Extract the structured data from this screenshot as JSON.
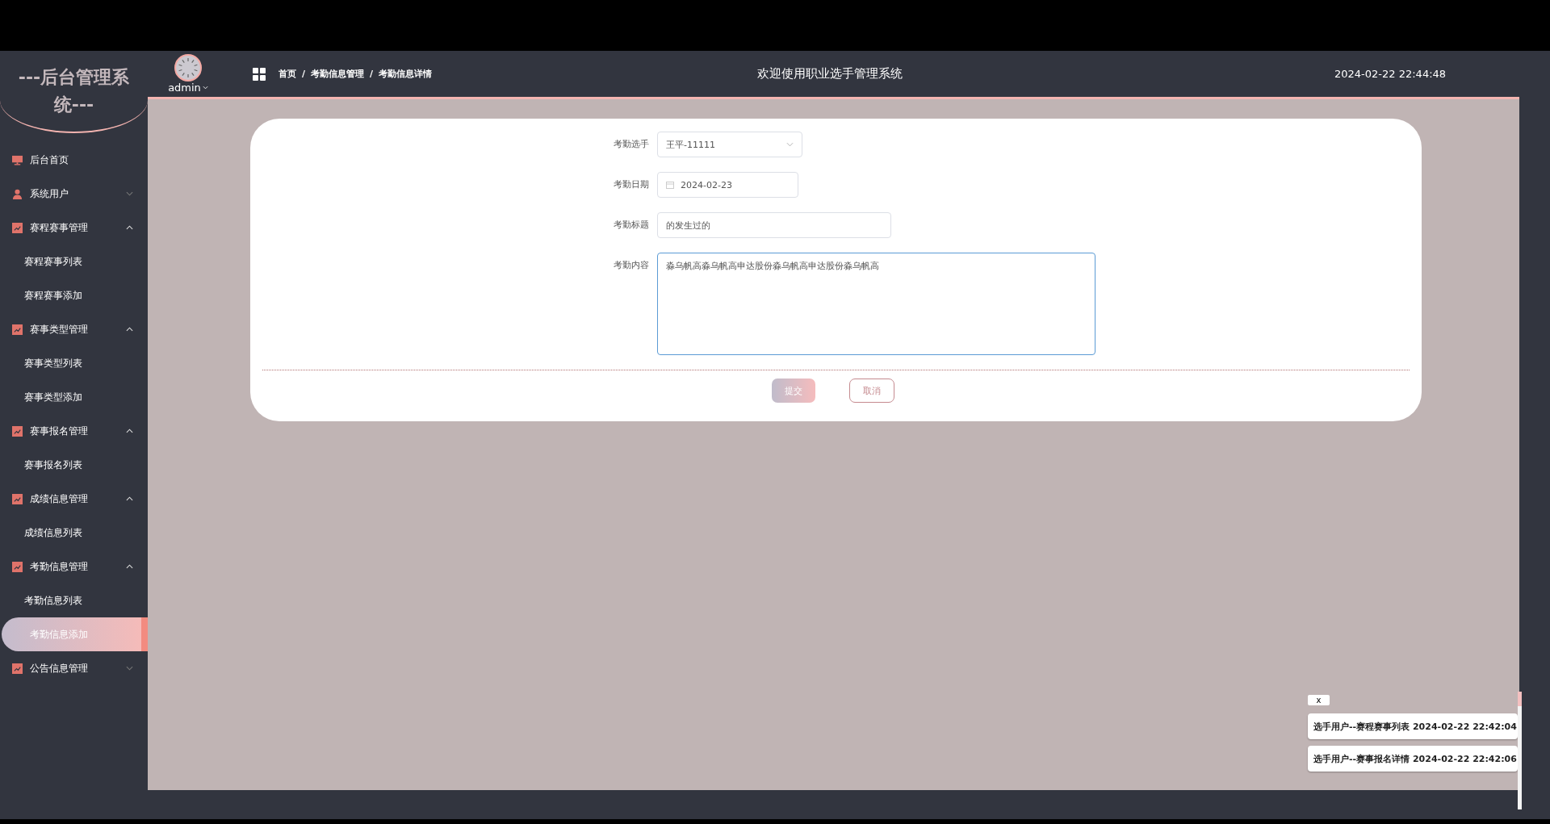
{
  "logo": {
    "title": "---后台管理系统---"
  },
  "user": {
    "name": "admin"
  },
  "breadcrumb": {
    "separator": "/",
    "items": [
      "首页",
      "考勤信息管理",
      "考勤信息详情"
    ]
  },
  "header": {
    "title": "欢迎使用职业选手管理系统",
    "time": "2024-02-22 22:44:48"
  },
  "sidebar": {
    "items": [
      {
        "kind": "home",
        "label": "后台首页",
        "selected": false
      },
      {
        "kind": "user",
        "label": "系统用户",
        "expanded": false,
        "selected": false
      },
      {
        "kind": "group",
        "label": "赛程赛事管理",
        "expanded": true,
        "selected": false
      },
      {
        "kind": "sub",
        "label": "赛程赛事列表",
        "selected": false
      },
      {
        "kind": "sub",
        "label": "赛程赛事添加",
        "selected": false
      },
      {
        "kind": "group",
        "label": "赛事类型管理",
        "expanded": true,
        "selected": false
      },
      {
        "kind": "sub",
        "label": "赛事类型列表",
        "selected": false
      },
      {
        "kind": "sub",
        "label": "赛事类型添加",
        "selected": false
      },
      {
        "kind": "group",
        "label": "赛事报名管理",
        "expanded": true,
        "selected": false
      },
      {
        "kind": "sub",
        "label": "赛事报名列表",
        "selected": false
      },
      {
        "kind": "group",
        "label": "成绩信息管理",
        "expanded": true,
        "selected": false
      },
      {
        "kind": "sub",
        "label": "成绩信息列表",
        "selected": false
      },
      {
        "kind": "group",
        "label": "考勤信息管理",
        "expanded": true,
        "selected": false
      },
      {
        "kind": "sub",
        "label": "考勤信息列表",
        "selected": false
      },
      {
        "kind": "sub",
        "label": "考勤信息添加",
        "selected": true
      },
      {
        "kind": "group",
        "label": "公告信息管理",
        "expanded": false,
        "selected": false
      }
    ]
  },
  "form": {
    "fields": [
      {
        "kind": "select",
        "label": "考勤选手",
        "value": "王平-11111"
      },
      {
        "kind": "date",
        "label": "考勤日期",
        "value": "2024-02-23"
      },
      {
        "kind": "text",
        "label": "考勤标题",
        "value": "的发生过的"
      },
      {
        "kind": "textarea",
        "label": "考勤内容",
        "value": "淼乌帆高淼乌帆高申达股份淼乌帆高申达股份淼乌帆高"
      }
    ],
    "buttons": [
      {
        "kind": "primary",
        "label": "提交"
      },
      {
        "kind": "secondary",
        "label": "取消"
      }
    ]
  },
  "notifications": {
    "close": "x",
    "items": [
      {
        "text": "选手用户--赛程赛事列表 2024-02-22 22:42:04"
      },
      {
        "text": "选手用户--赛事报名详情 2024-02-22 22:42:06"
      }
    ]
  }
}
